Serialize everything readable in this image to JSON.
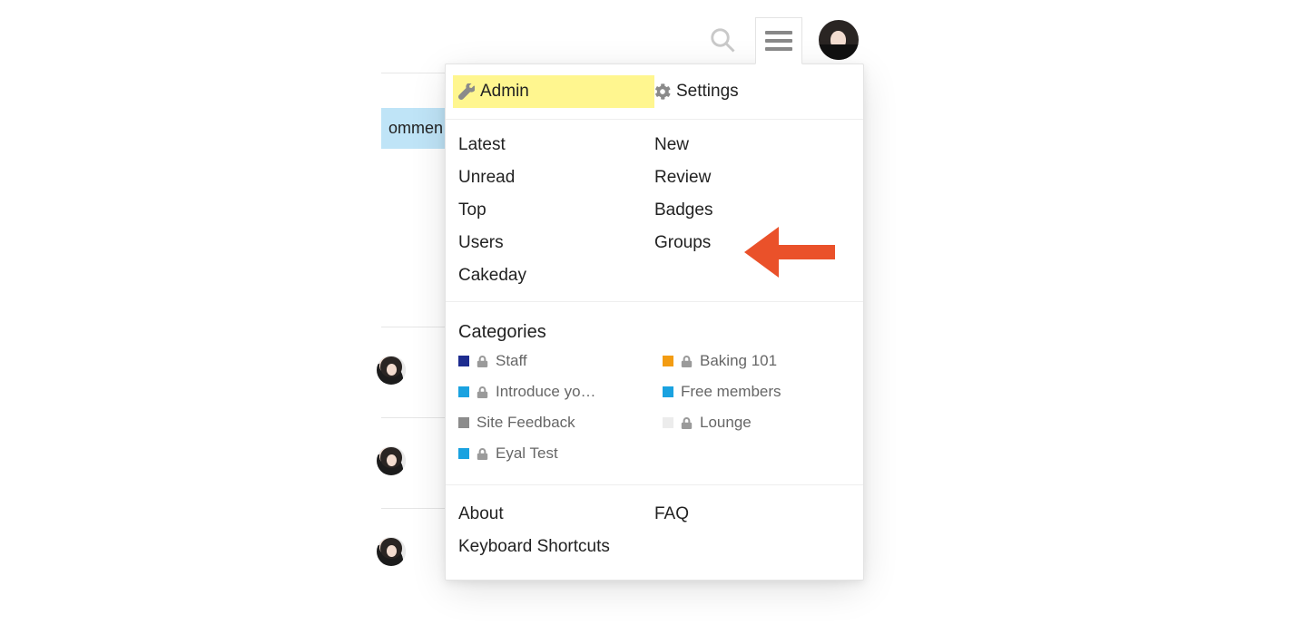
{
  "background": {
    "tag_fragment": "ommen"
  },
  "menu": {
    "admin_label": "Admin",
    "settings_label": "Settings",
    "nav_left": [
      "Latest",
      "Unread",
      "Top",
      "Users",
      "Cakeday"
    ],
    "nav_right": [
      "New",
      "Review",
      "Badges",
      "Groups"
    ],
    "categories_heading": "Categories",
    "categories_left": [
      {
        "name": "Staff",
        "color": "#1d2c8f",
        "locked": true
      },
      {
        "name": "Introduce yo…",
        "color": "#1aa2e0",
        "locked": true
      },
      {
        "name": "Site Feedback",
        "color": "#8c8c8c",
        "locked": false
      },
      {
        "name": "Eyal Test",
        "color": "#1aa2e0",
        "locked": true
      }
    ],
    "categories_right": [
      {
        "name": "Baking 101",
        "color": "#f39c12",
        "locked": true
      },
      {
        "name": "Free members",
        "color": "#1aa2e0",
        "locked": false
      },
      {
        "name": "Lounge",
        "color": "#ececec",
        "locked": true
      }
    ],
    "footer_left": [
      "About",
      "Keyboard Shortcuts"
    ],
    "footer_right": [
      "FAQ"
    ]
  },
  "annotation": {
    "arrow_color": "#ea512a"
  }
}
